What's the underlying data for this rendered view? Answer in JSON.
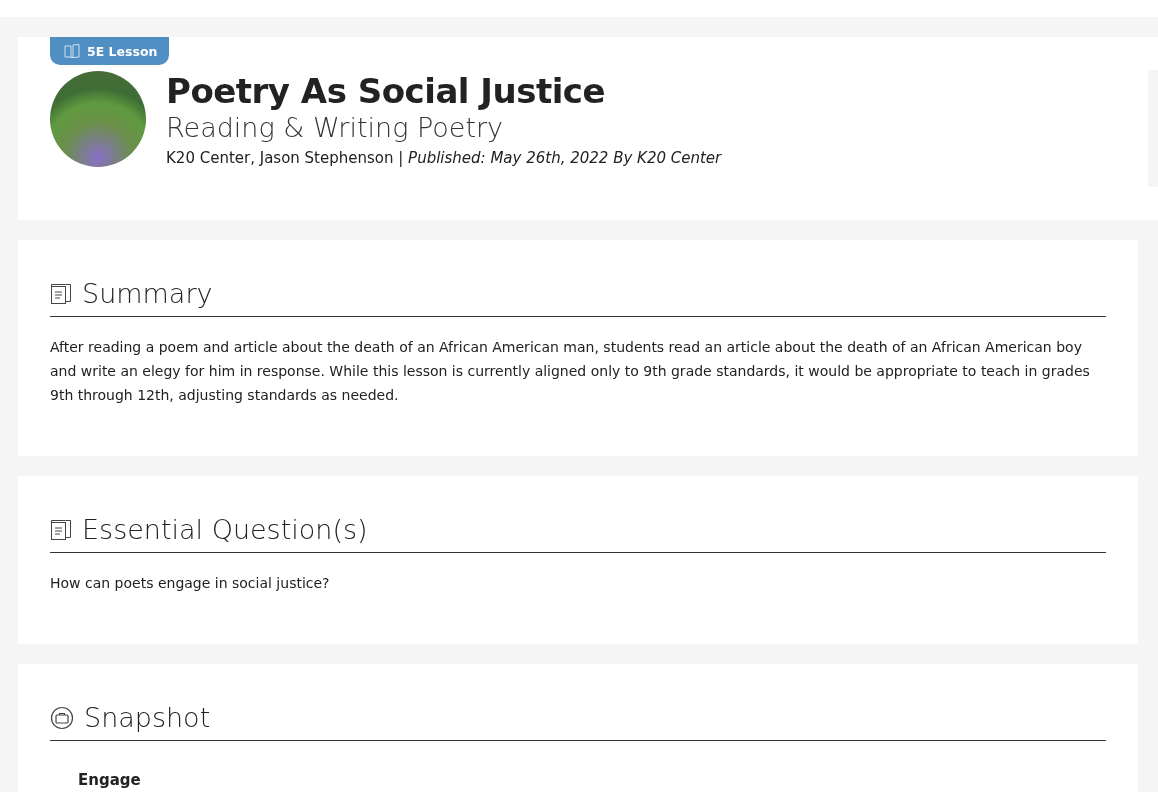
{
  "lesson": {
    "badge": "5E Lesson",
    "title": "Poetry As Social Justice",
    "subtitle": "Reading & Writing Poetry",
    "byline": "K20 Center, Jason Stephenson | *Published: May 26th, 2022 By K20 Center*"
  },
  "sections": [
    {
      "kind": "document",
      "heading": "Summary",
      "body": "After reading a poem and article about the death of an African American man, students read an article about the death of an African American boy and write an elegy for him in response. While this lesson is currently aligned only to 9th grade standards, it would be appropriate to teach in grades 9th through 12th, adjusting standards as needed."
    },
    {
      "kind": "document",
      "heading": "Essential Question(s)",
      "body": "How can poets engage in social justice?"
    },
    {
      "kind": "snapshot",
      "heading": "Snapshot",
      "subheading": "Engage"
    }
  ]
}
